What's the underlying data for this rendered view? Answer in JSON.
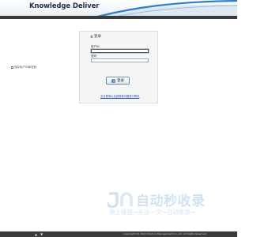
{
  "header": {
    "logo_text": "Knowledge Deliver"
  },
  "login": {
    "title": "登录",
    "user_label": "用户ID",
    "user_value": "",
    "password_label": "密码",
    "password_value": "",
    "remember_label": "保存用户ID和密码",
    "remember_checked": false,
    "login_button_label": "登录",
    "register_link": "无法登录以及因登录问题进行联系"
  },
  "watermark": {
    "logo_text": "自动秒收录",
    "tagline": "做上链接→来访一次→自动收录→"
  },
  "footer": {
    "nav_up": "▲",
    "nav_down": "▼",
    "copyright": "Copyright (C) 2024 Practice Management Co.,Ltd. All Rights Reserved."
  },
  "colors": {
    "header_bar": "#3a3a3a",
    "panel_bg": "#f5f5f5",
    "link": "#2a4fb0",
    "swoosh": "#2a7fd1",
    "watermark": "#cfe3f4"
  }
}
